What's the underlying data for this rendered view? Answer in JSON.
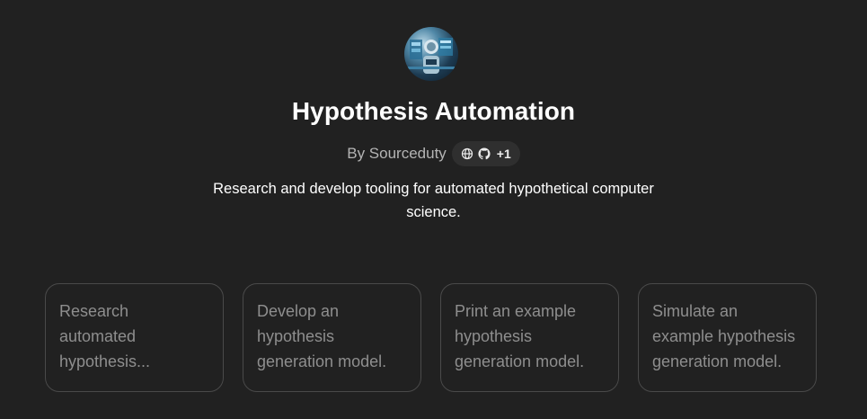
{
  "gpt": {
    "title": "Hypothesis Automation",
    "author": "By Sourceduty",
    "links_more": "+1",
    "link_icons": [
      "globe-icon",
      "github-icon"
    ],
    "description": "Research and develop tooling for automated hypothetical computer science."
  },
  "starters": [
    {
      "label": "Research automated hypothesis..."
    },
    {
      "label": "Develop an hypothesis generation model."
    },
    {
      "label": "Print an example hypothesis generation model."
    },
    {
      "label": "Simulate an example hypothesis generation model."
    }
  ],
  "colors": {
    "background": "#212121",
    "pill": "#2f2f2f",
    "card_border": "#4a4a4a",
    "muted_text": "#8e8e8e"
  }
}
